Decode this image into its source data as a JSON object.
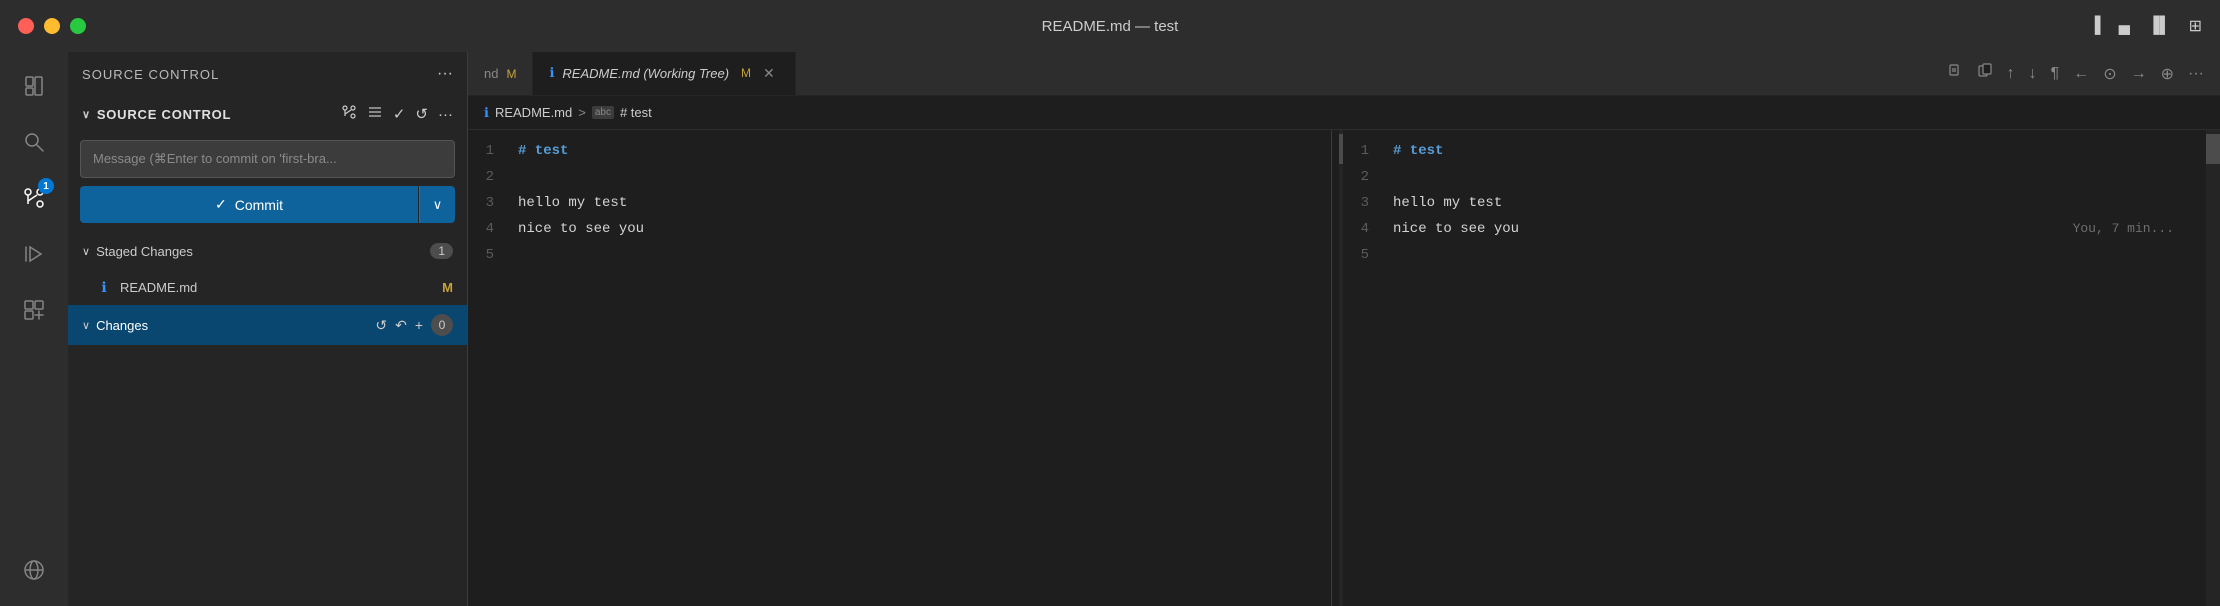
{
  "titlebar": {
    "title": "README.md — test",
    "traffic": {
      "close": "close",
      "minimize": "minimize",
      "maximize": "maximize"
    },
    "window_icons": [
      "sidebar-toggle",
      "panel-toggle",
      "layout-toggle",
      "more-layout"
    ]
  },
  "activity_bar": {
    "items": [
      {
        "id": "explorer",
        "icon": "⧉",
        "label": "Explorer",
        "active": false
      },
      {
        "id": "search",
        "icon": "🔍",
        "label": "Search",
        "active": false
      },
      {
        "id": "source-control",
        "icon": "⑂",
        "label": "Source Control",
        "active": true,
        "badge": "1"
      },
      {
        "id": "run",
        "icon": "▷",
        "label": "Run and Debug",
        "active": false
      },
      {
        "id": "extensions",
        "icon": "⊞",
        "label": "Extensions",
        "active": false
      },
      {
        "id": "remote",
        "icon": "⚡",
        "label": "Remote",
        "active": false
      }
    ]
  },
  "sidebar": {
    "header": {
      "title": "SOURCE CONTROL",
      "more_label": "···"
    },
    "source_control": {
      "section_title": "SOURCE CONTROL",
      "message_placeholder": "Message (⌘Enter to commit on 'first-bra...",
      "commit_button": "Commit",
      "commit_dropdown_icon": "∨",
      "staged_changes": {
        "label": "Staged Changes",
        "count": "1",
        "files": [
          {
            "name": "README.md",
            "status": "M",
            "icon": "ℹ"
          }
        ]
      },
      "changes": {
        "label": "Changes",
        "count": "0",
        "icons": [
          "↺",
          "↶",
          "+"
        ]
      }
    }
  },
  "editor": {
    "inactive_tab": {
      "label": "nd M",
      "modified": "M"
    },
    "active_tab": {
      "icon": "ℹ",
      "label": "README.md (Working Tree)",
      "modified": "M",
      "close": "✕"
    },
    "tab_actions": [
      "copy-path",
      "copy-rel-path",
      "scroll-up",
      "scroll-down",
      "show-whitespace",
      "prev-change",
      "next-change",
      "navigate",
      "more"
    ],
    "breadcrumb": {
      "icon": "ℹ",
      "file": "README.md",
      "sep": ">",
      "abc_label": "abc",
      "section": "# test"
    },
    "left_pane": {
      "lines": [
        {
          "num": "1",
          "content": "# test",
          "class": "heading"
        },
        {
          "num": "2",
          "content": ""
        },
        {
          "num": "3",
          "content": "hello my test"
        },
        {
          "num": "4",
          "content": "nice to see you"
        },
        {
          "num": "5",
          "content": ""
        }
      ]
    },
    "right_pane": {
      "lines": [
        {
          "num": "1",
          "content": "# test",
          "class": "heading"
        },
        {
          "num": "2",
          "content": ""
        },
        {
          "num": "3",
          "content": "hello my test"
        },
        {
          "num": "4",
          "content": "nice to see you",
          "annotation": "You, 7 min..."
        },
        {
          "num": "5",
          "content": ""
        }
      ]
    }
  }
}
